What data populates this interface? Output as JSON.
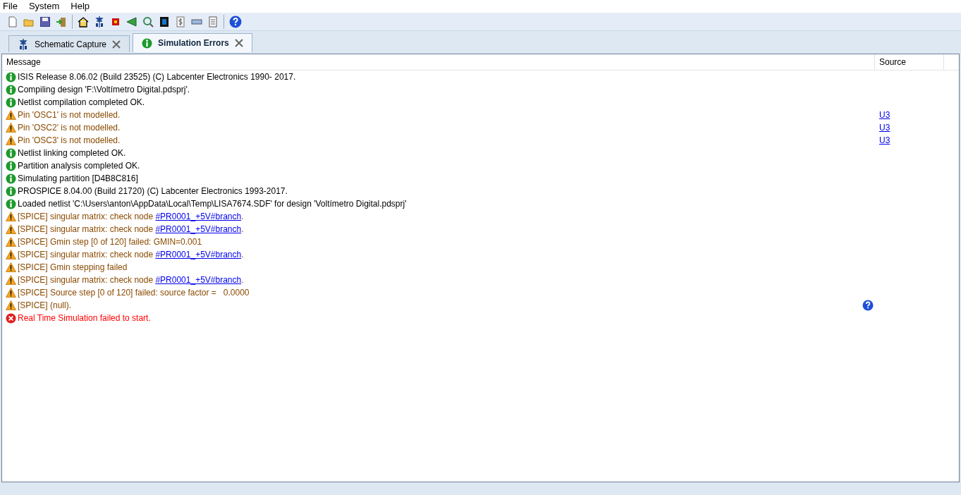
{
  "menu": [
    "File",
    "System",
    "Help"
  ],
  "tabs": [
    {
      "label": "Schematic Capture",
      "kind": "schematic",
      "selected": false
    },
    {
      "label": "Simulation Errors",
      "kind": "info",
      "selected": true
    }
  ],
  "table": {
    "columns": [
      "Message",
      "Source"
    ],
    "rows": [
      {
        "kind": "info",
        "text": "ISIS Release 8.06.02 (Build 23525) (C) Labcenter Electronics 1990- 2017."
      },
      {
        "kind": "info",
        "text": "Compiling design 'F:\\Voltímetro Digital.pdsprj'."
      },
      {
        "kind": "info",
        "text": "Netlist compilation completed OK."
      },
      {
        "kind": "warning",
        "text": "Pin 'OSC1' is not modelled.",
        "source": "U3"
      },
      {
        "kind": "warning",
        "text": "Pin 'OSC2' is not modelled.",
        "source": "U3"
      },
      {
        "kind": "warning",
        "text": "Pin 'OSC3' is not modelled.",
        "source": "U3"
      },
      {
        "kind": "info",
        "text": "Netlist linking completed OK."
      },
      {
        "kind": "info",
        "text": "Partition analysis completed OK."
      },
      {
        "kind": "info",
        "text": "Simulating partition [D4B8C816]"
      },
      {
        "kind": "info",
        "text": "PROSPICE 8.04.00 (Build 21720) (C) Labcenter Electronics 1993-2017."
      },
      {
        "kind": "info",
        "text": "Loaded netlist 'C:\\Users\\anton\\AppData\\Local\\Temp\\LISA7674.SDF' for design 'Voltímetro Digital.pdsprj'"
      },
      {
        "kind": "warning",
        "text": "[SPICE] singular matrix: check node ",
        "link": "#PR0001_+5V#branch",
        "suffix": "."
      },
      {
        "kind": "warning",
        "text": "[SPICE] singular matrix: check node ",
        "link": "#PR0001_+5V#branch",
        "suffix": "."
      },
      {
        "kind": "warning",
        "text": "[SPICE] Gmin step [0 of 120] failed: GMIN=0.001"
      },
      {
        "kind": "warning",
        "text": "[SPICE] singular matrix: check node ",
        "link": "#PR0001_+5V#branch",
        "suffix": "."
      },
      {
        "kind": "warning",
        "text": "[SPICE] Gmin stepping failed"
      },
      {
        "kind": "warning",
        "text": "[SPICE] singular matrix: check node ",
        "link": "#PR0001_+5V#branch",
        "suffix": "."
      },
      {
        "kind": "warning",
        "text": "[SPICE] Source step [0 of 120] failed: source factor =   0.0000"
      },
      {
        "kind": "warning",
        "text": "[SPICE] (null).",
        "help": true
      },
      {
        "kind": "error",
        "text": "Real Time Simulation failed to start."
      }
    ]
  }
}
